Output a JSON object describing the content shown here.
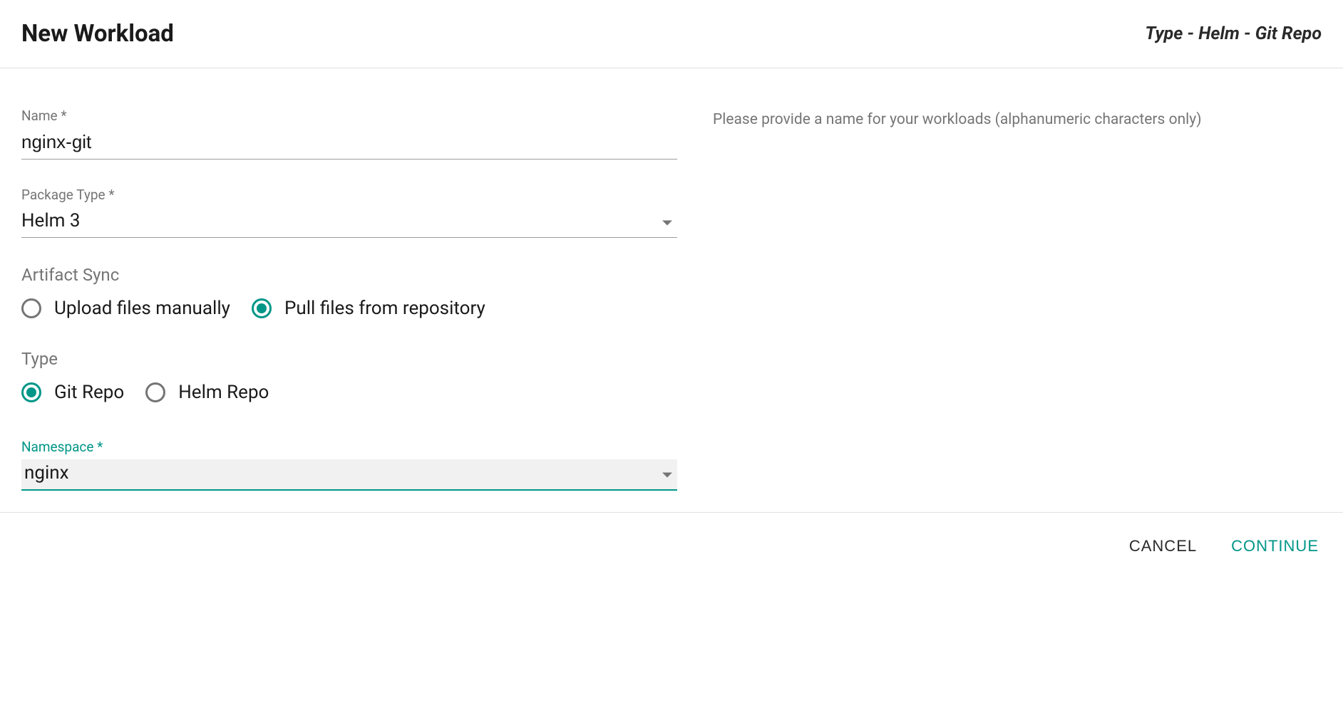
{
  "header": {
    "title": "New Workload",
    "subtitle": "Type - Helm - Git Repo"
  },
  "form": {
    "name": {
      "label": "Name *",
      "value": "nginx-git"
    },
    "packageType": {
      "label": "Package Type *",
      "value": "Helm 3"
    },
    "artifactSync": {
      "label": "Artifact Sync",
      "options": {
        "upload": "Upload files manually",
        "pull": "Pull files from repository"
      },
      "selected": "pull"
    },
    "type": {
      "label": "Type",
      "options": {
        "git": "Git Repo",
        "helm": "Helm Repo"
      },
      "selected": "git"
    },
    "namespace": {
      "label": "Namespace *",
      "value": "nginx"
    }
  },
  "helper": {
    "name": "Please provide a name for your workloads (alphanumeric characters only)"
  },
  "footer": {
    "cancel": "CANCEL",
    "continue": "CONTINUE"
  }
}
